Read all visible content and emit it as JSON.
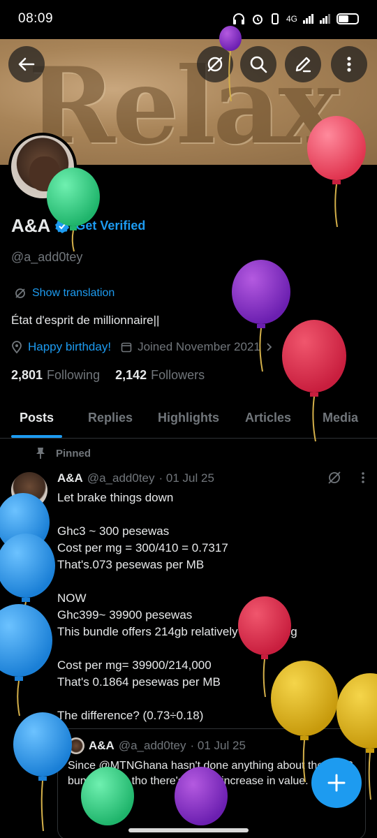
{
  "status_bar": {
    "time": "08:09",
    "network": "4G",
    "battery_label": "battery"
  },
  "header": {
    "banner_text": "Relax",
    "back_icon": "back-arrow-icon",
    "translate_icon": "translate-off-icon",
    "search_icon": "search-icon",
    "edit_icon": "edit-pencil-icon",
    "more_icon": "more-vertical-icon"
  },
  "profile": {
    "name": "A&A",
    "get_verified": "Get Verified",
    "handle": "@a_add0tey",
    "show_translation": "Show translation",
    "bio": "État d'esprit de millionnaire||",
    "birthday": "Happy birthday!",
    "joined": "Joined November 2021",
    "following_count": "2,801",
    "following_label": "Following",
    "followers_count": "2,142",
    "followers_label": "Followers"
  },
  "tabs": [
    {
      "label": "Posts",
      "active": true
    },
    {
      "label": "Replies",
      "active": false
    },
    {
      "label": "Highlights",
      "active": false
    },
    {
      "label": "Articles",
      "active": false
    },
    {
      "label": "Media",
      "active": false
    }
  ],
  "post": {
    "pinned_label": "Pinned",
    "name": "A&A",
    "handle": "@a_add0tey",
    "date": "· 01 Jul 25",
    "body": "Let brake things down\n\nGhc3 ~ 300 pesewas\nCost per mg = 300/410 = 0.7317\nThat's.073 pesewas per MB\n\nNOW\nGhc399~ 39900 pesewas\nThis bundle offers 214gb relatively 214000mg\n\nCost per mg= 39900/214,000\nThat's 0.1864 pesewas per MB\n\nThe difference? (0.73÷0.18)",
    "quote": {
      "name": "A&A",
      "handle": "@a_add0tey",
      "date": "· 01 Jul 25",
      "text": "Since @MTNGhana  hasn't done anything about the Ghc3 bundle even tho there's a 15% increase in value."
    }
  },
  "fab": {
    "label": "+"
  },
  "colors": {
    "accent": "#1d9bf0",
    "background": "#000000",
    "text": "#e7e9ea",
    "muted": "#71767b"
  }
}
